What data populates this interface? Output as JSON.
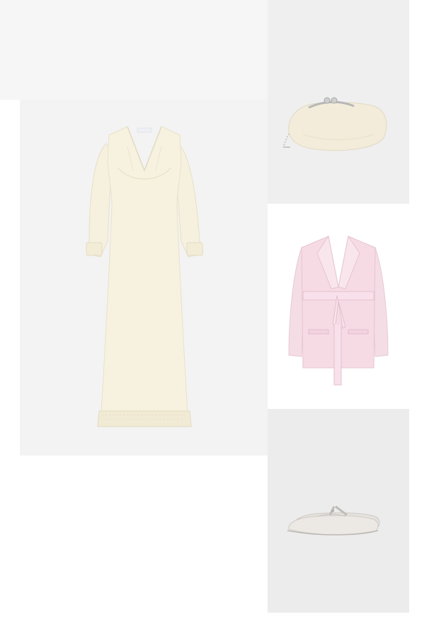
{
  "outfit": {
    "items": [
      {
        "id": "dress",
        "icon": "long-sleeve-maxi-dress",
        "color": "#f7f1df"
      },
      {
        "id": "clutch",
        "icon": "pouch-clutch-bag",
        "color": "#f3ecda"
      },
      {
        "id": "blazer",
        "icon": "belted-satin-blazer",
        "color": "#f6d9e4"
      },
      {
        "id": "shoes",
        "icon": "mary-jane-ballet-flat",
        "color": "#e6e2de"
      }
    ],
    "tile_colors": {
      "dress": "#f3f3f3",
      "clutch": "#efefef",
      "blazer": "#ffffff",
      "shoes": "#ececec"
    }
  }
}
